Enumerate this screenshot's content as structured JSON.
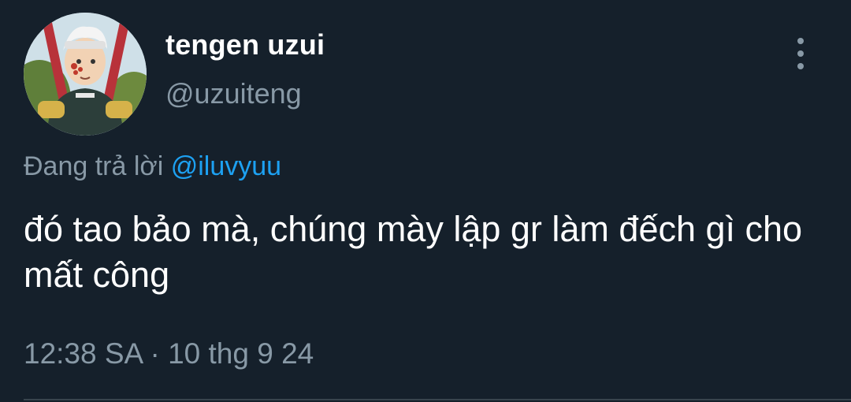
{
  "tweet": {
    "author": {
      "display_name": "tengen uzui",
      "handle": "@uzuiteng",
      "avatar": "anime-character-avatar"
    },
    "more_icon": "more-vertical-icon",
    "reply_prefix": "Đang trả lời",
    "reply_mention": "@iluvyuu",
    "text": "đó tao bảo mà, chúng mày lập gr làm đếch gì cho mất công",
    "timestamp": "12:38 SA · 10 thg 9 24"
  },
  "colors": {
    "background": "#15202b",
    "primary_text": "#ffffff",
    "secondary_text": "#8899a6",
    "accent": "#1da1f2",
    "divider": "#38444d"
  }
}
